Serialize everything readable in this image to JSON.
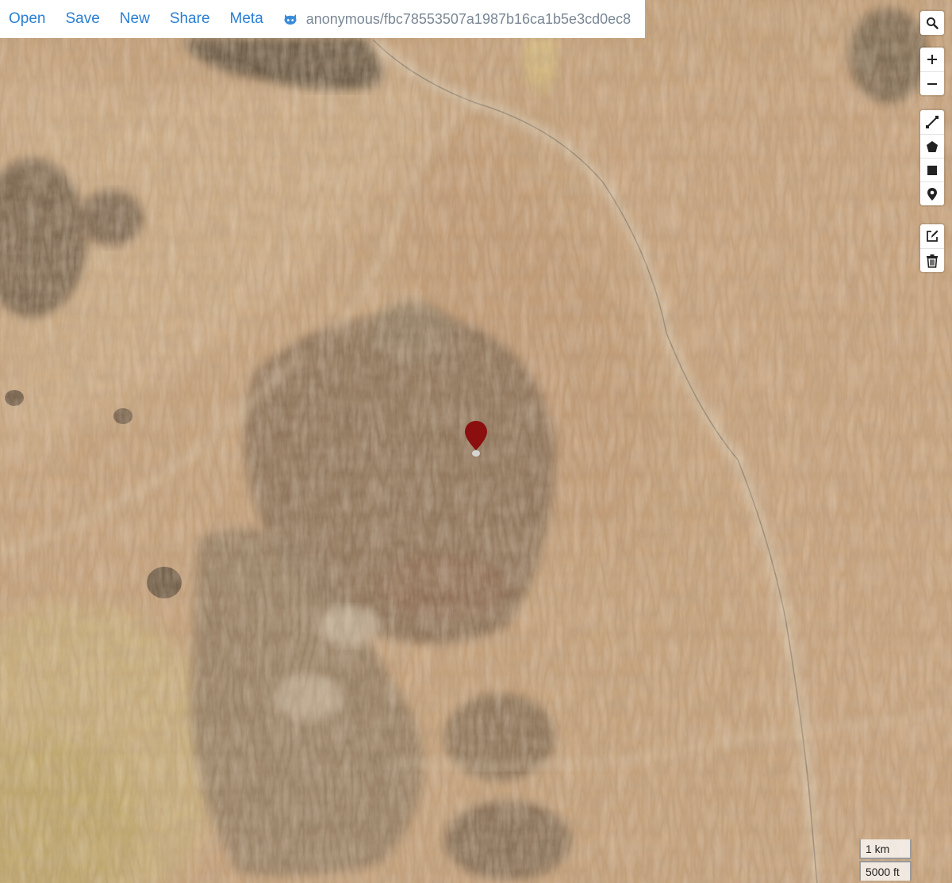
{
  "topbar": {
    "menu": [
      "Open",
      "Save",
      "New",
      "Share",
      "Meta"
    ],
    "gist_icon": "github-icon",
    "gist_label": "anonymous/fbc78553507a1987b16ca1b5e3cd0ec8"
  },
  "controls": {
    "search_icon": "search-icon",
    "zoom_in": "+",
    "zoom_out": "−",
    "draw_tools": [
      "line-icon",
      "polygon-icon",
      "rectangle-icon",
      "marker-icon"
    ],
    "edit_tools": [
      "edit-icon",
      "trash-icon"
    ]
  },
  "scale": {
    "metric": "1 km",
    "imperial": "5000 ft"
  },
  "map": {
    "basemap": "satellite",
    "marker_color": "#8b0f0f",
    "link_color": "#2a7fd4"
  }
}
